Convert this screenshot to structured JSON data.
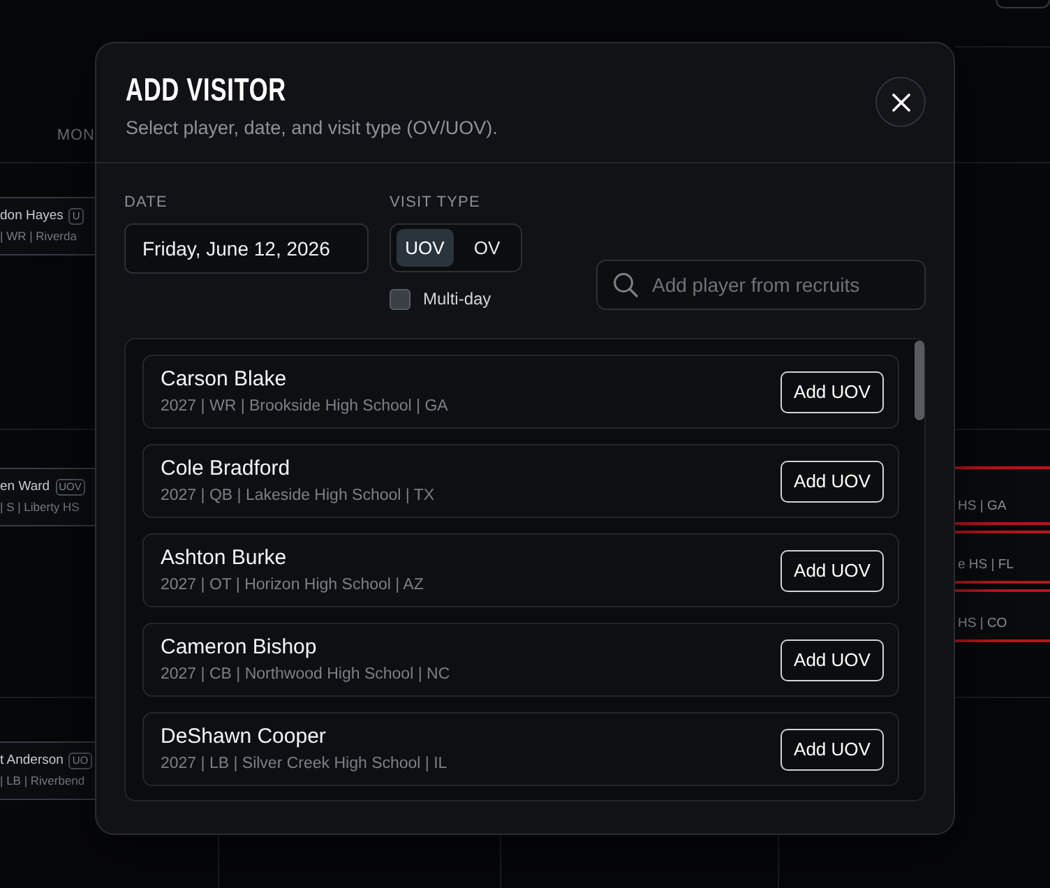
{
  "calendar": {
    "day_header": "MON",
    "left_events": [
      {
        "name": "don Hayes",
        "badge": "U",
        "details": "| WR | Riverda"
      },
      {
        "name": "en Ward",
        "badge": "UOV",
        "details": "| S | Liberty HS"
      },
      {
        "name": "t Anderson",
        "badge": "UO",
        "details": "| LB | Riverbend"
      }
    ],
    "right_events": [
      {
        "details": "HS | GA"
      },
      {
        "details": "e HS | FL"
      },
      {
        "details": "HS | CO"
      }
    ]
  },
  "modal": {
    "title": "ADD VISITOR",
    "subtitle": "Select player, date, and visit type (OV/UOV).",
    "date": {
      "label": "DATE",
      "value": "Friday, June 12, 2026"
    },
    "visit_type": {
      "label": "VISIT TYPE",
      "options": [
        {
          "label": "UOV",
          "selected": true
        },
        {
          "label": "OV",
          "selected": false
        }
      ]
    },
    "multi_day": {
      "label": "Multi-day",
      "checked": false
    },
    "search": {
      "placeholder": "Add player from recruits"
    },
    "players": [
      {
        "name": "Carson Blake",
        "details": "2027 | WR | Brookside High School | GA",
        "action": "Add UOV"
      },
      {
        "name": "Cole Bradford",
        "details": "2027 | QB | Lakeside High School | TX",
        "action": "Add UOV"
      },
      {
        "name": "Ashton Burke",
        "details": "2027 | OT | Horizon High School | AZ",
        "action": "Add UOV"
      },
      {
        "name": "Cameron Bishop",
        "details": "2027 | CB | Northwood High School | NC",
        "action": "Add UOV"
      },
      {
        "name": "DeShawn Cooper",
        "details": "2027 | LB | Silver Creek High School | IL",
        "action": "Add UOV"
      }
    ]
  }
}
